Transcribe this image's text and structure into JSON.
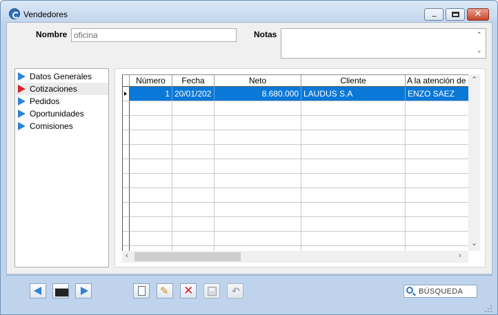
{
  "window": {
    "title": "Vendedores"
  },
  "form": {
    "nombre_label": "Nombre",
    "nombre_value": "oficina",
    "notas_label": "Notas",
    "notas_value": ""
  },
  "nav": {
    "items": [
      {
        "label": "Datos Generales",
        "icon_color": "#2f82d6"
      },
      {
        "label": "Cotizaciones",
        "icon_color": "#d9242b",
        "selected": true
      },
      {
        "label": "Pedidos",
        "icon_color": "#2f82d6"
      },
      {
        "label": "Oportunidades",
        "icon_color": "#2f82d6"
      },
      {
        "label": "Comisiones",
        "icon_color": "#2f82d6"
      }
    ]
  },
  "grid": {
    "columns": [
      "Número",
      "Fecha",
      "Neto",
      "Cliente",
      "A la atención de"
    ],
    "rows": [
      {
        "numero": "1",
        "fecha": "20/01/202",
        "neto": "8.680.000",
        "cliente": "LAUDUS S.A",
        "atencion": "ENZO SAEZ"
      }
    ],
    "selection_color": "#0a78d7"
  },
  "toolbar": {
    "search_label": "BÚSQUEDA",
    "buttons": [
      {
        "name": "previous",
        "icon": "triangle-left-icon"
      },
      {
        "name": "find",
        "icon": "binoculars-icon"
      },
      {
        "name": "next",
        "icon": "triangle-right-icon"
      },
      {
        "name": "new",
        "icon": "new-document-icon"
      },
      {
        "name": "edit",
        "icon": "pencil-icon"
      },
      {
        "name": "delete",
        "icon": "red-x-icon"
      },
      {
        "name": "save",
        "icon": "floppy-disk-icon"
      },
      {
        "name": "undo",
        "icon": "undo-icon"
      }
    ]
  }
}
